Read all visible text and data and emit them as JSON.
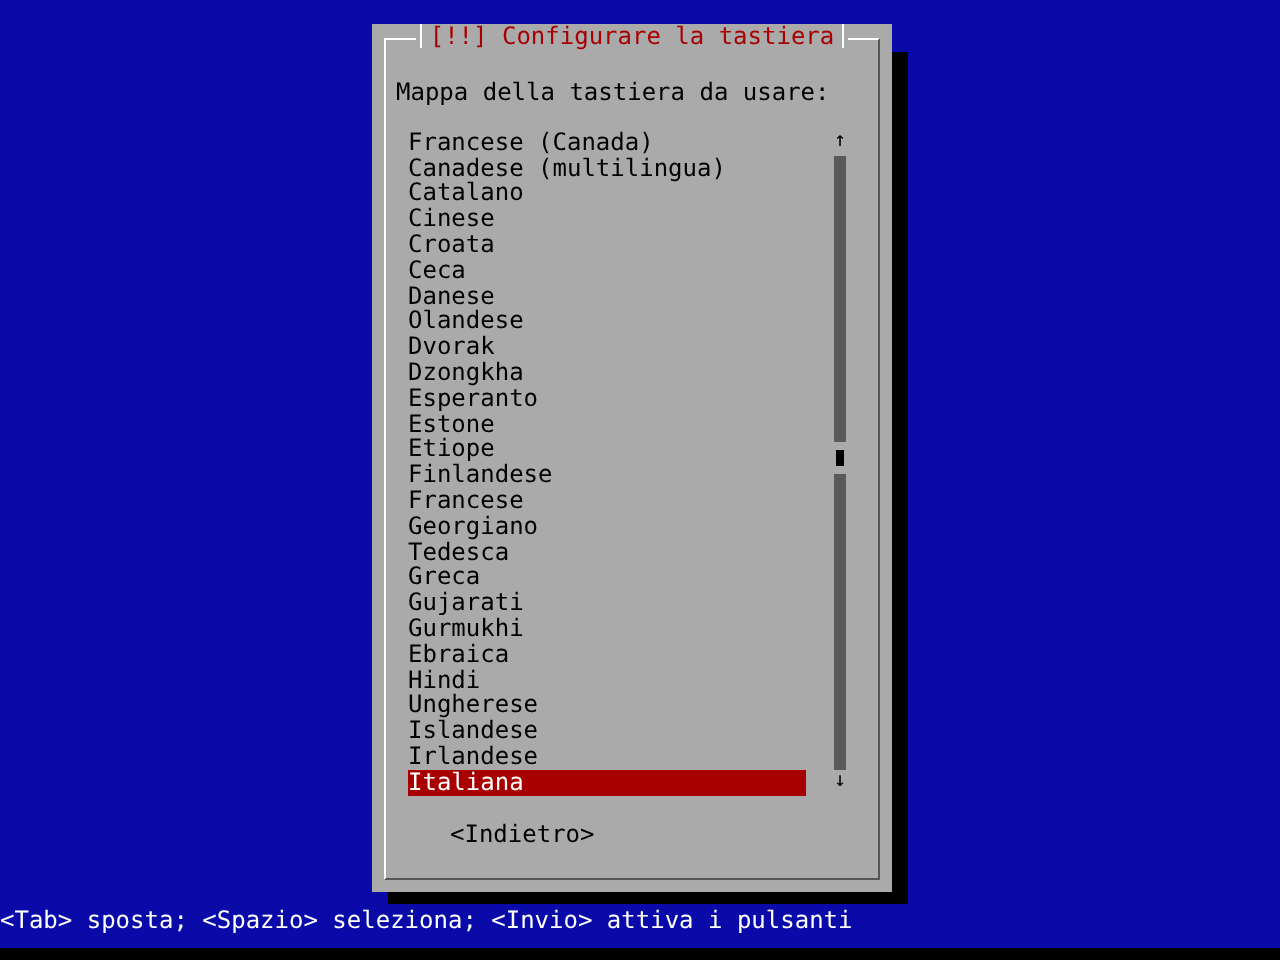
{
  "dialog": {
    "title": "[!!] Configurare la tastiera",
    "prompt": "Mappa della tastiera da usare:",
    "items": [
      {
        "label": "Francese (Canada)",
        "selected": false
      },
      {
        "label": "Canadese (multilingua)",
        "selected": false
      },
      {
        "label": "Catalano",
        "selected": false
      },
      {
        "label": "Cinese",
        "selected": false
      },
      {
        "label": "Croata",
        "selected": false
      },
      {
        "label": "Ceca",
        "selected": false
      },
      {
        "label": "Danese",
        "selected": false
      },
      {
        "label": "Olandese",
        "selected": false
      },
      {
        "label": "Dvorak",
        "selected": false
      },
      {
        "label": "Dzongkha",
        "selected": false
      },
      {
        "label": "Esperanto",
        "selected": false
      },
      {
        "label": "Estone",
        "selected": false
      },
      {
        "label": "Etiope",
        "selected": false
      },
      {
        "label": "Finlandese",
        "selected": false
      },
      {
        "label": "Francese",
        "selected": false
      },
      {
        "label": "Georgiano",
        "selected": false
      },
      {
        "label": "Tedesca",
        "selected": false
      },
      {
        "label": "Greca",
        "selected": false
      },
      {
        "label": "Gujarati",
        "selected": false
      },
      {
        "label": "Gurmukhi",
        "selected": false
      },
      {
        "label": "Ebraica",
        "selected": false
      },
      {
        "label": "Hindi",
        "selected": false
      },
      {
        "label": "Ungherese",
        "selected": false
      },
      {
        "label": "Islandese",
        "selected": false
      },
      {
        "label": "Irlandese",
        "selected": false
      },
      {
        "label": "Italiana",
        "selected": true
      }
    ],
    "scroll_up": "↑",
    "scroll_down": "↓",
    "back_button": "<Indietro>"
  },
  "status_bar": "<Tab> sposta; <Spazio> seleziona; <Invio> attiva i pulsanti"
}
